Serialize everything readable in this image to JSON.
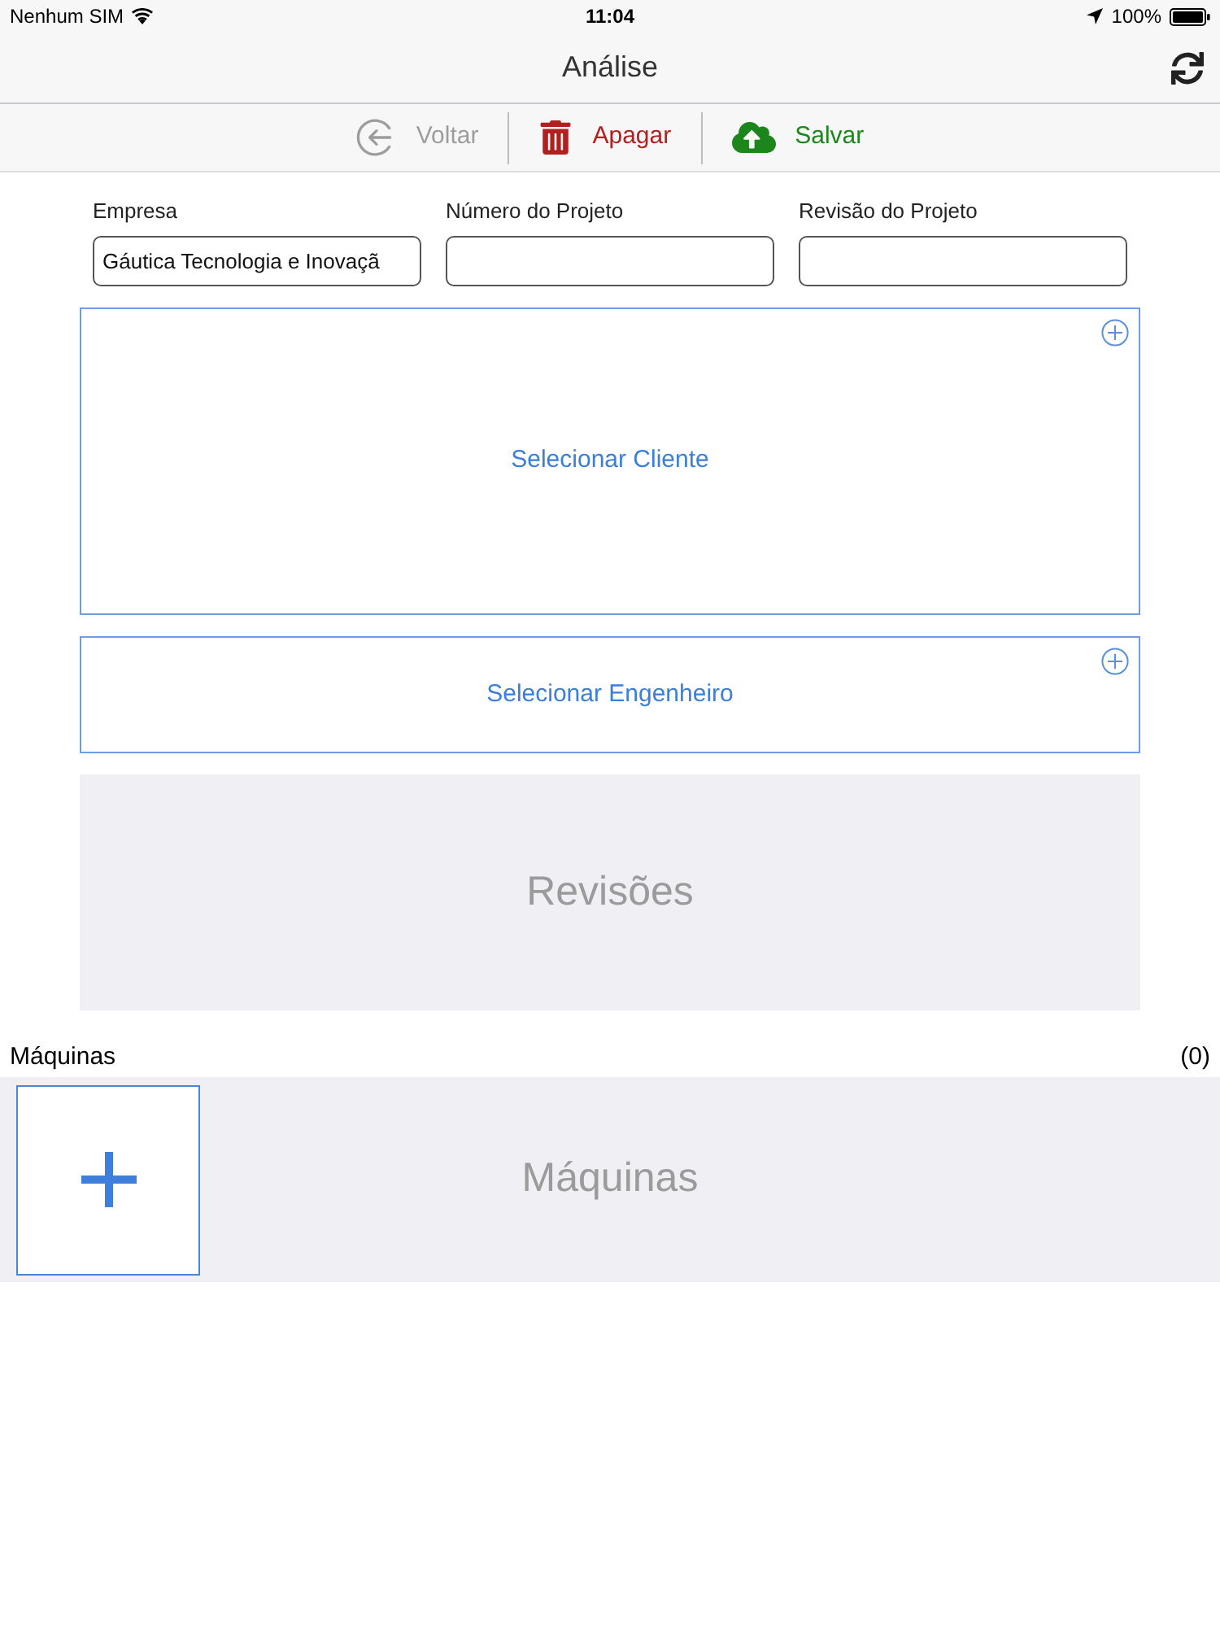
{
  "status_bar": {
    "carrier": "Nenhum SIM",
    "time": "11:04",
    "battery": "100%"
  },
  "nav_bar": {
    "title": "Análise"
  },
  "toolbar": [
    {
      "kind": "back",
      "label": "Voltar",
      "disabled": true
    },
    {
      "kind": "delete",
      "label": "Apagar",
      "disabled": false
    },
    {
      "kind": "save",
      "label": "Salvar",
      "disabled": false
    }
  ],
  "form": {
    "fields": [
      {
        "label": "Empresa",
        "value": "Gáutica Tecnologia e Inovaçã"
      },
      {
        "label": "Número do Projeto"
      },
      {
        "label": "Revisão do Projeto"
      }
    ]
  },
  "client_picker": {
    "label": "Selecionar Cliente"
  },
  "engineer_picker": {
    "label": "Selecionar Engenheiro"
  },
  "revisions": {
    "label": "Revisões"
  },
  "machines": {
    "title": "Máquinas",
    "count": "(0)",
    "empty_label": "Máquinas"
  }
}
